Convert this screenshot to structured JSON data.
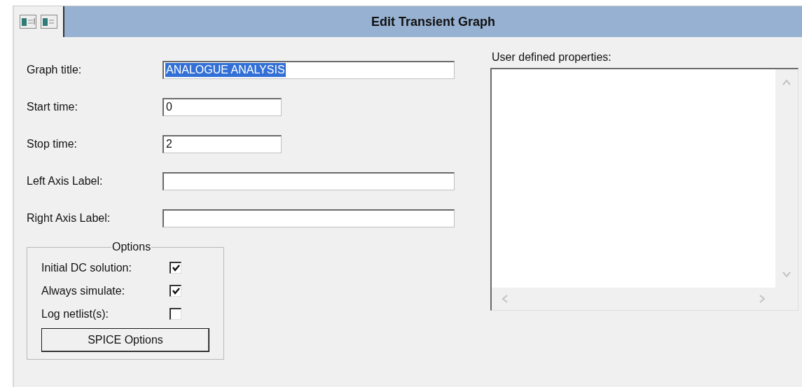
{
  "window": {
    "title": "Edit Transient Graph"
  },
  "fields": [
    {
      "label": "Graph title:",
      "value": "ANALOGUE ANALYSIS",
      "selected": true,
      "kind": "wide"
    },
    {
      "label": "Start time:",
      "value": "0",
      "selected": false,
      "kind": "short"
    },
    {
      "label": "Stop time:",
      "value": "2",
      "selected": false,
      "kind": "short"
    },
    {
      "label": "Left Axis Label:",
      "selected": false,
      "kind": "wide"
    },
    {
      "label": "Right Axis Label:",
      "selected": false,
      "kind": "wide"
    }
  ],
  "options": {
    "title": "Options",
    "items": [
      {
        "label": "Initial DC solution:",
        "checked": true
      },
      {
        "label": "Always simulate:",
        "checked": true
      },
      {
        "label": "Log netlist(s):",
        "checked": false
      }
    ],
    "button": "SPICE Options"
  },
  "properties": {
    "label": "User defined properties:"
  }
}
